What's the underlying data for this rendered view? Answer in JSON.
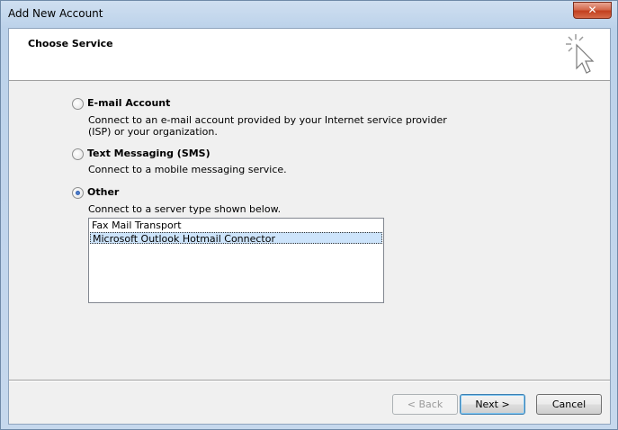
{
  "window": {
    "title": "Add New Account",
    "close_label": "✕"
  },
  "header": {
    "title": "Choose Service",
    "icon": "wizard-cursor-icon"
  },
  "options": [
    {
      "label": "E-mail Account",
      "description": "Connect to an e-mail account provided by your Internet service provider (ISP) or your organization.",
      "checked": false
    },
    {
      "label": "Text Messaging (SMS)",
      "description": "Connect to a mobile messaging service.",
      "checked": false
    },
    {
      "label": "Other",
      "description": "Connect to a server type shown below.",
      "checked": true
    }
  ],
  "server_types": {
    "items": [
      "Fax Mail Transport",
      "Microsoft Outlook Hotmail Connector"
    ],
    "selected": "Microsoft Outlook Hotmail Connector"
  },
  "buttons": {
    "back": "< Back",
    "next": "Next >",
    "cancel": "Cancel"
  }
}
